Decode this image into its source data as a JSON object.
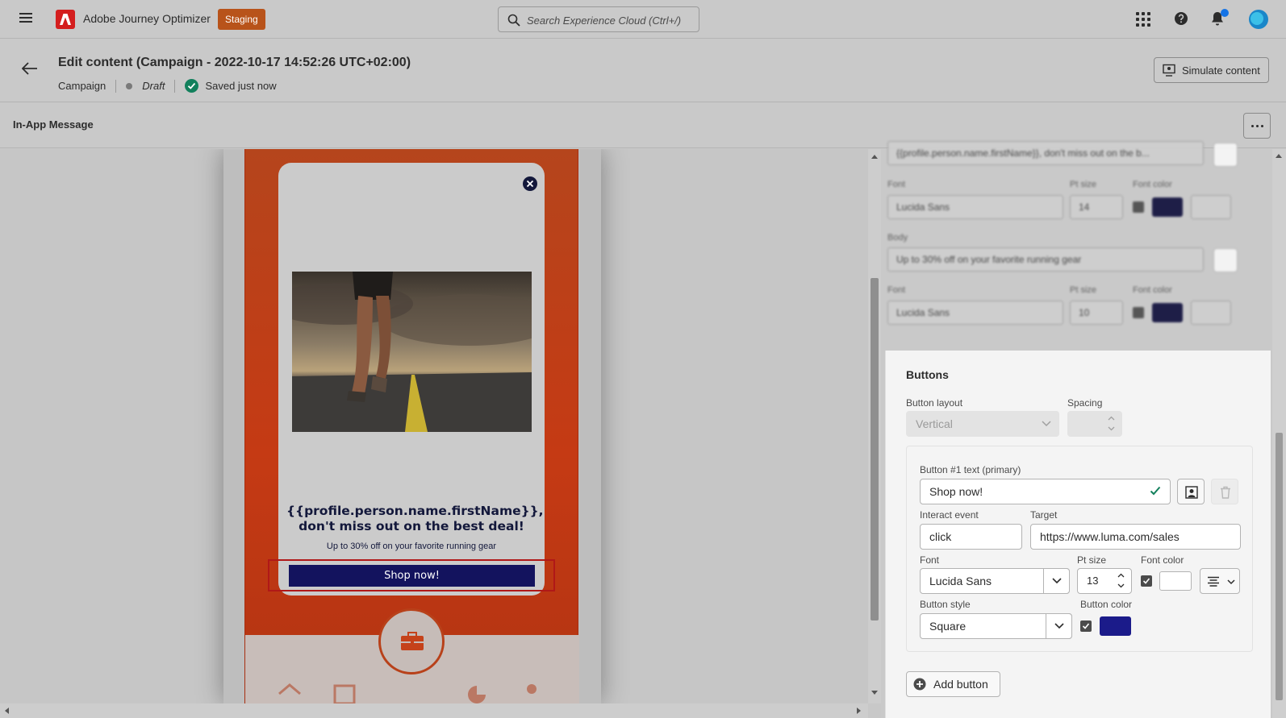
{
  "topbar": {
    "app_title": "Adobe Journey Optimizer",
    "env_badge": "Staging",
    "search_placeholder": "Search Experience Cloud (Ctrl+/)",
    "icons": [
      "menu-icon",
      "adobe-logo-icon",
      "search-icon",
      "app-grid-icon",
      "help-icon",
      "bell-icon",
      "avatar"
    ]
  },
  "header": {
    "title": "Edit content (Campaign - 2022-10-17 14:52:26 UTC+02:00)",
    "type": "Campaign",
    "status": "Draft",
    "saved": "Saved just now",
    "simulate_label": "Simulate content"
  },
  "channel": {
    "title": "In-App Message"
  },
  "preview": {
    "message_title": "{{profile.person.name.firstName}}, don't miss out on the best deal!",
    "message_body": "Up to 30% off on your favorite running gear",
    "cta_label": "Shop now!",
    "cta_color": "#13135e",
    "background_color": "#c53a14"
  },
  "panel_blurred": {
    "title_value": "{{profile.person.name.firstName}}, don't miss out on the b...",
    "font_label": "Font",
    "ptsize_label": "Pt size",
    "fontcolor_label": "Font color",
    "title_font": "Lucida Sans",
    "title_size": "14",
    "body_label": "Body",
    "body_value": "Up to 30% off on your favorite running gear",
    "body_font": "Lucida Sans",
    "body_size": "10"
  },
  "buttons": {
    "section_title": "Buttons",
    "layout_label": "Button layout",
    "layout_value": "Vertical",
    "spacing_label": "Spacing",
    "button1": {
      "text_label": "Button #1 text (primary)",
      "text_value": "Shop now!",
      "interact_label": "Interact event",
      "interact_value": "click",
      "target_label": "Target",
      "target_value": "https://www.luma.com/sales",
      "font_label": "Font",
      "font_value": "Lucida Sans",
      "ptsize_label": "Pt size",
      "ptsize_value": "13",
      "fontcolor_label": "Font color",
      "font_color": "#ffffff",
      "style_label": "Button style",
      "style_value": "Square",
      "buttoncolor_label": "Button color",
      "button_color": "#1b1b8a"
    },
    "add_label": "Add button"
  }
}
